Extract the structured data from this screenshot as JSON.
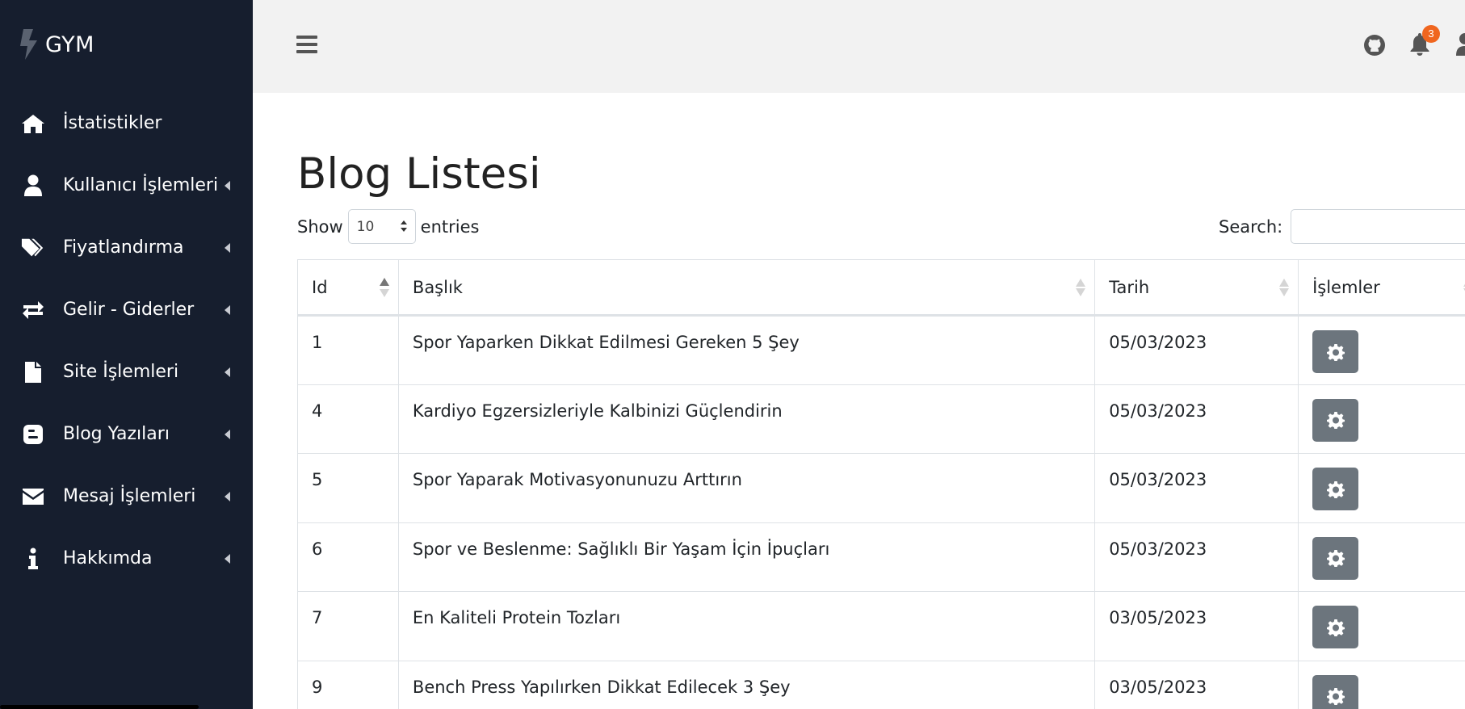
{
  "app": {
    "brand": "GYM"
  },
  "sidebar": {
    "items": [
      {
        "label": "İstatistikler",
        "icon": "home-icon",
        "has_caret": false
      },
      {
        "label": "Kullanıcı İşlemleri",
        "icon": "user-icon",
        "has_caret": true
      },
      {
        "label": "Fiyatlandırma",
        "icon": "tags-icon",
        "has_caret": true
      },
      {
        "label": "Gelir - Giderler",
        "icon": "exchange-icon",
        "has_caret": true
      },
      {
        "label": "Site İşlemleri",
        "icon": "file-icon",
        "has_caret": true
      },
      {
        "label": "Blog Yazıları",
        "icon": "blogger-icon",
        "has_caret": true
      },
      {
        "label": "Mesaj İşlemleri",
        "icon": "envelope-icon",
        "has_caret": true
      },
      {
        "label": "Hakkımda",
        "icon": "info-icon",
        "has_caret": true
      }
    ]
  },
  "topbar": {
    "notification_count": "3"
  },
  "main": {
    "title": "Blog Listesi",
    "length": {
      "prefix": "Show",
      "value": "10",
      "suffix": "entries"
    },
    "search": {
      "label": "Search:",
      "value": ""
    },
    "table": {
      "headers": [
        "Id",
        "Başlık",
        "Tarih",
        "İşlemler"
      ],
      "rows": [
        {
          "id": "1",
          "title": "Spor Yaparken Dikkat Edilmesi Gereken 5 Şey",
          "date": "05/03/2023"
        },
        {
          "id": "4",
          "title": "Kardiyo Egzersizleriyle Kalbinizi Güçlendirin",
          "date": "05/03/2023"
        },
        {
          "id": "5",
          "title": "Spor Yaparak Motivasyonunuzu Arttırın",
          "date": "05/03/2023"
        },
        {
          "id": "6",
          "title": "Spor ve Beslenme: Sağlıklı Bir Yaşam İçin İpuçları",
          "date": "05/03/2023"
        },
        {
          "id": "7",
          "title": "En Kaliteli Protein Tozları",
          "date": "03/05/2023"
        },
        {
          "id": "9",
          "title": "Bench Press Yapılırken Dikkat Edilecek 3 Şey",
          "date": "03/05/2023"
        }
      ]
    }
  },
  "colors": {
    "sidebar_bg": "#161e2e",
    "topbar_bg": "#f2f2f2",
    "button_bg": "#6c757d",
    "badge_bg": "#f0661f"
  }
}
